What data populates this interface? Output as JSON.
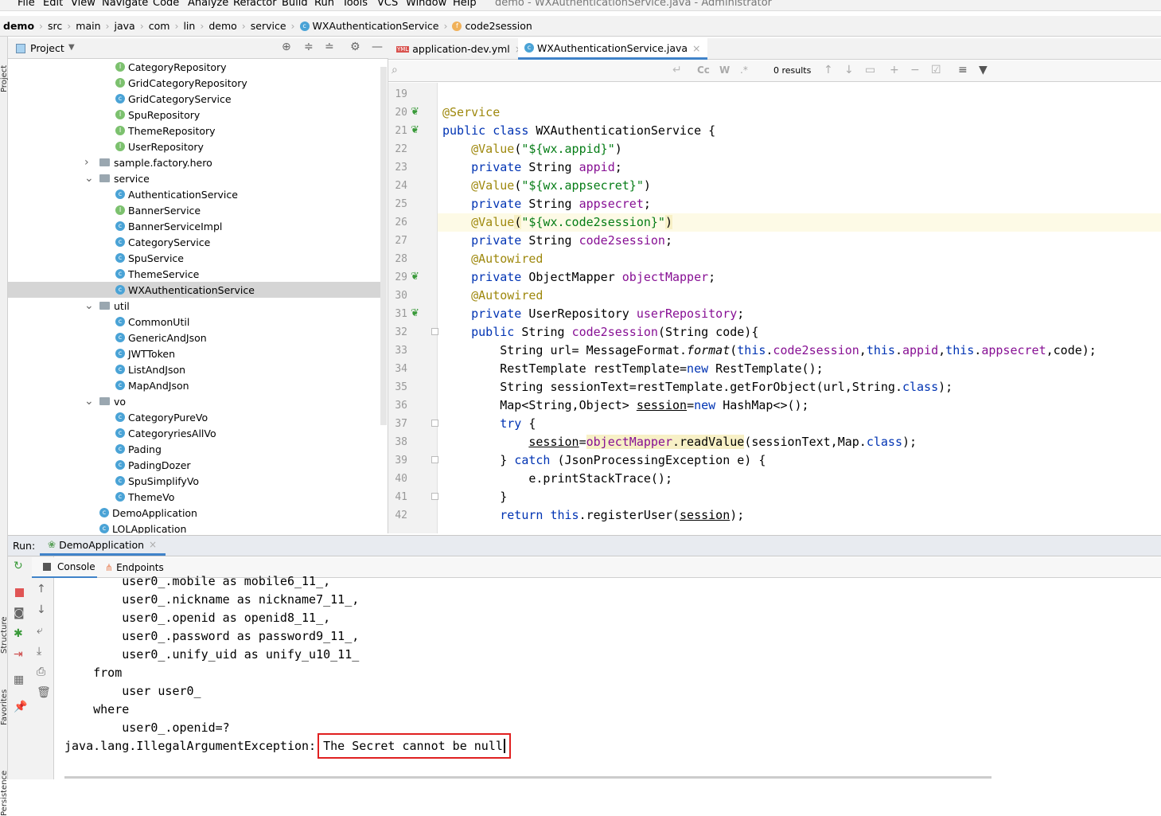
{
  "menu": {
    "items": [
      "File",
      "Edit",
      "View",
      "Navigate",
      "Code",
      "Analyze",
      "Refactor",
      "Build",
      "Run",
      "Tools",
      "VCS",
      "Window",
      "Help"
    ],
    "title": "demo - WXAuthenticationService.java - Administrator"
  },
  "breadcrumb": [
    {
      "label": "demo",
      "bold": true
    },
    {
      "label": "src"
    },
    {
      "label": "main"
    },
    {
      "label": "java"
    },
    {
      "label": "com"
    },
    {
      "label": "lin"
    },
    {
      "label": "demo"
    },
    {
      "label": "service"
    },
    {
      "label": "WXAuthenticationService",
      "badge": "C"
    },
    {
      "label": "code2session",
      "badge": "f"
    }
  ],
  "project": {
    "title": "Project",
    "side_label": "Project",
    "tree": [
      {
        "label": "CategoryRepository",
        "type": "I",
        "depth": 2
      },
      {
        "label": "GridCategoryRepository",
        "type": "I",
        "depth": 2
      },
      {
        "label": "GridCategoryService",
        "type": "C",
        "depth": 2
      },
      {
        "label": "SpuRepository",
        "type": "I",
        "depth": 2
      },
      {
        "label": "ThemeRepository",
        "type": "I",
        "depth": 2
      },
      {
        "label": "UserRepository",
        "type": "I",
        "depth": 2
      },
      {
        "label": "sample.factory.hero",
        "type": "folder",
        "depth": 1,
        "expanded": false
      },
      {
        "label": "service",
        "type": "folder",
        "depth": 1,
        "expanded": true
      },
      {
        "label": "AuthenticationService",
        "type": "C",
        "depth": 2
      },
      {
        "label": "BannerService",
        "type": "I",
        "depth": 2
      },
      {
        "label": "BannerServiceImpl",
        "type": "C",
        "depth": 2
      },
      {
        "label": "CategoryService",
        "type": "C",
        "depth": 2
      },
      {
        "label": "SpuService",
        "type": "C",
        "depth": 2
      },
      {
        "label": "ThemeService",
        "type": "C",
        "depth": 2
      },
      {
        "label": "WXAuthenticationService",
        "type": "C",
        "depth": 2,
        "selected": true
      },
      {
        "label": "util",
        "type": "folder",
        "depth": 1,
        "expanded": true
      },
      {
        "label": "CommonUtil",
        "type": "C",
        "depth": 2
      },
      {
        "label": "GenericAndJson",
        "type": "C",
        "depth": 2
      },
      {
        "label": "JWTToken",
        "type": "C",
        "depth": 2
      },
      {
        "label": "ListAndJson",
        "type": "C",
        "depth": 2
      },
      {
        "label": "MapAndJson",
        "type": "C",
        "depth": 2
      },
      {
        "label": "vo",
        "type": "folder",
        "depth": 1,
        "expanded": true
      },
      {
        "label": "CategoryPureVo",
        "type": "C",
        "depth": 2
      },
      {
        "label": "CategoryriesAllVo",
        "type": "C",
        "depth": 2
      },
      {
        "label": "Pading",
        "type": "C",
        "depth": 2
      },
      {
        "label": "PadingDozer",
        "type": "C",
        "depth": 2
      },
      {
        "label": "SpuSimplifyVo",
        "type": "C",
        "depth": 2
      },
      {
        "label": "ThemeVo",
        "type": "C",
        "depth": 2
      },
      {
        "label": "DemoApplication",
        "type": "C",
        "depth": 1
      },
      {
        "label": "LOLApplication",
        "type": "C",
        "depth": 1
      }
    ]
  },
  "editor": {
    "tabs": [
      {
        "label": "application-dev.yml",
        "icon": "yml-file-icon"
      },
      {
        "label": "WXAuthenticationService.java",
        "icon": "class-icon",
        "active": true
      }
    ],
    "search": {
      "value": "",
      "results": "0 results",
      "cc": "Cc",
      "w": "W",
      "regex": ".*"
    },
    "lines": [
      {
        "n": "19",
        "t": []
      },
      {
        "n": "20",
        "t": [
          [
            "@Service",
            "ann"
          ]
        ]
      },
      {
        "n": "21",
        "t": [
          [
            "public class ",
            "kw"
          ],
          [
            "WXAuthenticationService {",
            ""
          ]
        ]
      },
      {
        "n": "22",
        "t": [
          [
            "    ",
            ""
          ],
          [
            "@Value",
            "ann"
          ],
          [
            "(",
            ""
          ],
          [
            "\"${wx.appid}\"",
            "str"
          ],
          [
            ")",
            ""
          ]
        ]
      },
      {
        "n": "23",
        "t": [
          [
            "    ",
            ""
          ],
          [
            "private ",
            "kw"
          ],
          [
            "String ",
            ""
          ],
          [
            "appid",
            "fld"
          ],
          [
            ";",
            ""
          ]
        ]
      },
      {
        "n": "24",
        "t": [
          [
            "    ",
            ""
          ],
          [
            "@Value",
            "ann"
          ],
          [
            "(",
            ""
          ],
          [
            "\"${wx.appsecret}\"",
            "str"
          ],
          [
            ")",
            ""
          ]
        ]
      },
      {
        "n": "25",
        "t": [
          [
            "    ",
            ""
          ],
          [
            "private ",
            "kw"
          ],
          [
            "String ",
            ""
          ],
          [
            "appsecret",
            "fld"
          ],
          [
            ";",
            ""
          ]
        ]
      },
      {
        "n": "26",
        "hl": true,
        "t": [
          [
            "    ",
            ""
          ],
          [
            "@Value",
            "ann"
          ],
          [
            "(",
            "mh"
          ],
          [
            "\"${wx.code2session}\"",
            "str"
          ],
          [
            ")",
            "mh"
          ]
        ]
      },
      {
        "n": "27",
        "t": [
          [
            "    ",
            ""
          ],
          [
            "private ",
            "kw"
          ],
          [
            "String ",
            ""
          ],
          [
            "code2session",
            "fld"
          ],
          [
            ";",
            ""
          ]
        ]
      },
      {
        "n": "28",
        "t": [
          [
            "    ",
            ""
          ],
          [
            "@Autowired",
            "ann"
          ]
        ]
      },
      {
        "n": "29",
        "t": [
          [
            "    ",
            ""
          ],
          [
            "private ",
            "kw"
          ],
          [
            "ObjectMapper ",
            ""
          ],
          [
            "objectMapper",
            "fld"
          ],
          [
            ";",
            ""
          ]
        ]
      },
      {
        "n": "30",
        "t": [
          [
            "    ",
            ""
          ],
          [
            "@Autowired",
            "ann"
          ]
        ]
      },
      {
        "n": "31",
        "t": [
          [
            "    ",
            ""
          ],
          [
            "private ",
            "kw"
          ],
          [
            "UserRepository ",
            ""
          ],
          [
            "userRepository",
            "fld"
          ],
          [
            ";",
            ""
          ]
        ]
      },
      {
        "n": "32",
        "t": [
          [
            "    ",
            ""
          ],
          [
            "public ",
            "kw"
          ],
          [
            "String ",
            ""
          ],
          [
            "code2session",
            "fld"
          ],
          [
            "(String code){",
            ""
          ]
        ]
      },
      {
        "n": "33",
        "t": [
          [
            "        String url= MessageFormat.",
            ""
          ],
          [
            "format",
            "it"
          ],
          [
            "(",
            ""
          ],
          [
            "this",
            "kw"
          ],
          [
            ".",
            ""
          ],
          [
            "code2session",
            "fld"
          ],
          [
            ",",
            ""
          ],
          [
            "this",
            "kw"
          ],
          [
            ".",
            ""
          ],
          [
            "appid",
            "fld"
          ],
          [
            ",",
            ""
          ],
          [
            "this",
            "kw"
          ],
          [
            ".",
            ""
          ],
          [
            "appsecret",
            "fld"
          ],
          [
            ",code);",
            ""
          ]
        ]
      },
      {
        "n": "34",
        "t": [
          [
            "        RestTemplate restTemplate=",
            ""
          ],
          [
            "new ",
            "kw"
          ],
          [
            "RestTemplate();",
            ""
          ]
        ]
      },
      {
        "n": "35",
        "t": [
          [
            "        String sessionText=restTemplate.getForObject(url,String.",
            ""
          ],
          [
            "class",
            "kw"
          ],
          [
            ");",
            ""
          ]
        ]
      },
      {
        "n": "36",
        "t": [
          [
            "        Map<String,Object> ",
            ""
          ],
          [
            "session",
            "ul"
          ],
          [
            "=",
            ""
          ],
          [
            "new ",
            "kw"
          ],
          [
            "HashMap<>();",
            ""
          ]
        ]
      },
      {
        "n": "37",
        "t": [
          [
            "        ",
            ""
          ],
          [
            "try ",
            "kw"
          ],
          [
            "{",
            ""
          ]
        ]
      },
      {
        "n": "38",
        "t": [
          [
            "            ",
            ""
          ],
          [
            "session",
            "ul"
          ],
          [
            "=",
            ""
          ],
          [
            "objectMapper",
            "fld mh"
          ],
          [
            ".readValue",
            "mh"
          ],
          [
            "(sessionText,Map.",
            ""
          ],
          [
            "class",
            "kw"
          ],
          [
            ");",
            ""
          ]
        ]
      },
      {
        "n": "39",
        "t": [
          [
            "        } ",
            ""
          ],
          [
            "catch ",
            "kw"
          ],
          [
            "(JsonProcessingException e) {",
            ""
          ]
        ]
      },
      {
        "n": "40",
        "t": [
          [
            "            e.printStackTrace();",
            ""
          ]
        ]
      },
      {
        "n": "41",
        "t": [
          [
            "        }",
            ""
          ]
        ]
      },
      {
        "n": "42",
        "t": [
          [
            "        ",
            ""
          ],
          [
            "return this",
            "kw"
          ],
          [
            ".registerUser(",
            ""
          ],
          [
            "session",
            "ul"
          ],
          [
            ");",
            ""
          ]
        ]
      }
    ]
  },
  "run": {
    "label": "Run:",
    "config": "DemoApplication",
    "tabs": [
      "Console",
      "Endpoints"
    ],
    "side_labels": [
      "Structure",
      "Favorites",
      "Persistence"
    ],
    "console": [
      "        user0_.mobile as mobile6_11_,",
      "        user0_.nickname as nickname7_11_,",
      "        user0_.openid as openid8_11_,",
      "        user0_.password as password9_11_,",
      "        user0_.unify_uid as unify_u10_11_",
      "    from",
      "        user user0_",
      "    where",
      "        user0_.openid=?"
    ],
    "error_prefix": "java.lang.IllegalArgumentException: ",
    "error_message": "The Secret cannot be null"
  },
  "colors": {
    "keyword": "#0033b3",
    "field": "#871094",
    "string": "#067d17",
    "annotation": "#9e880d",
    "highlight_box": "#e02020",
    "tab_accent": "#4083c9"
  }
}
